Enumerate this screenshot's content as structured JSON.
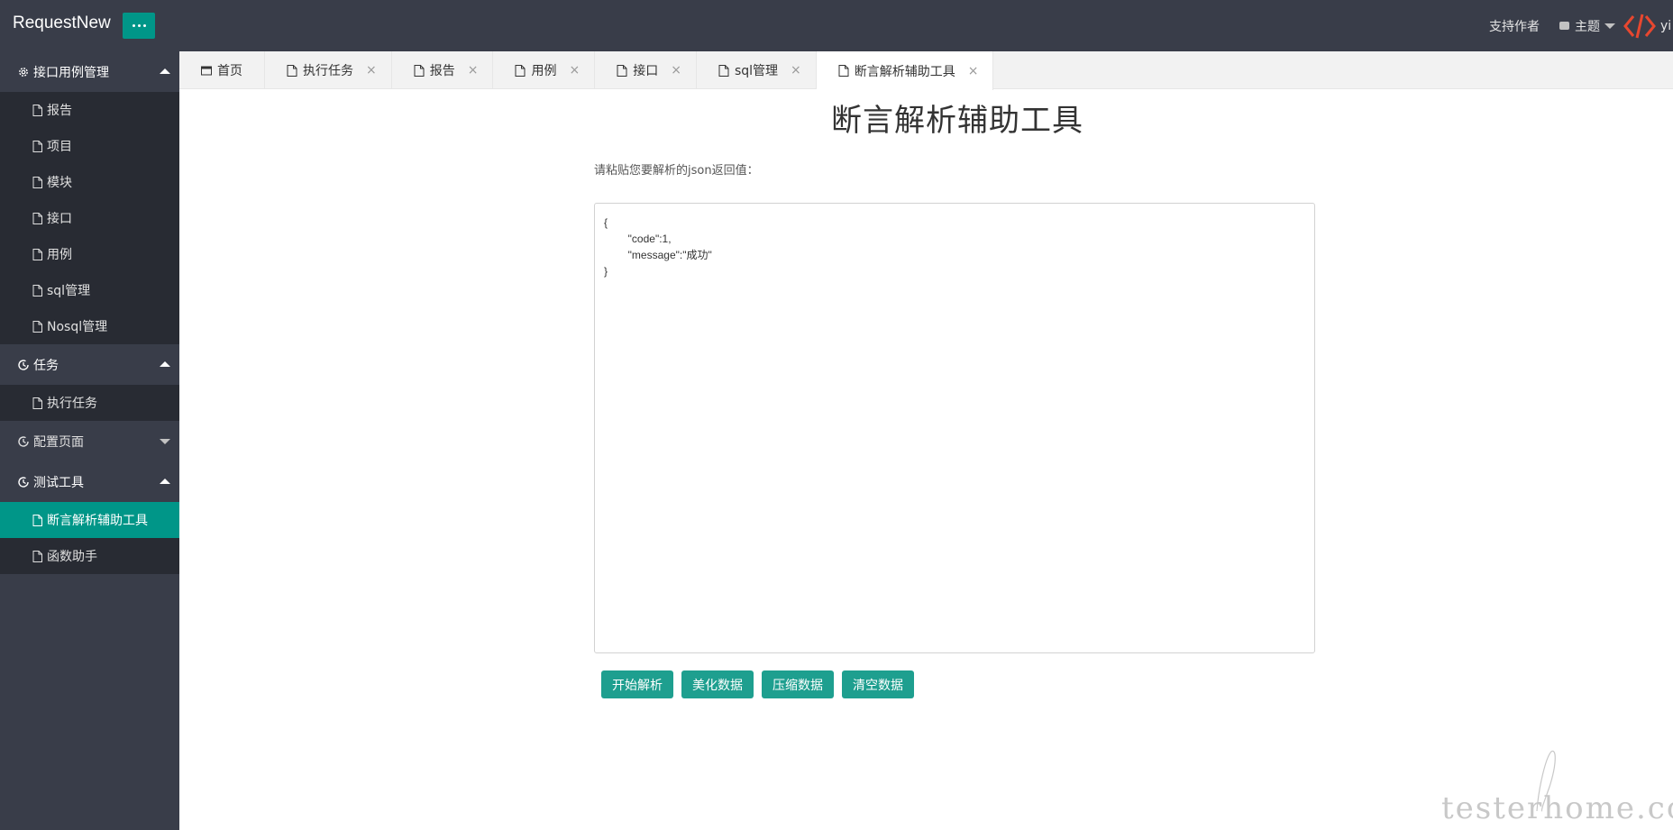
{
  "header": {
    "logo": "RequestNew",
    "support": "支持作者",
    "theme": "主题",
    "username": "yi",
    "colors": {
      "bar": "#393d49",
      "accent": "#009688",
      "code_logo": "#e8472f"
    }
  },
  "sidebar": {
    "groups": [
      {
        "label": "接口用例管理",
        "icon": "gear-icon",
        "expanded": true,
        "items": [
          "报告",
          "项目",
          "模块",
          "接口",
          "用例",
          "sql管理",
          "Nosql管理"
        ]
      },
      {
        "label": "任务",
        "icon": "clock-icon",
        "expanded": true,
        "items": [
          "执行任务"
        ]
      },
      {
        "label": "配置页面",
        "icon": "clock-icon",
        "expanded": false,
        "items": []
      },
      {
        "label": "测试工具",
        "icon": "clock-icon",
        "expanded": true,
        "items": [
          "断言解析辅助工具",
          "函数助手"
        ]
      }
    ],
    "active_item": "断言解析辅助工具"
  },
  "tabs": [
    {
      "label": "首页",
      "icon": "window-icon",
      "closable": false
    },
    {
      "label": "执行任务",
      "icon": "file-icon",
      "closable": true
    },
    {
      "label": "报告",
      "icon": "file-icon",
      "closable": true
    },
    {
      "label": "用例",
      "icon": "file-icon",
      "closable": true
    },
    {
      "label": "接口",
      "icon": "file-icon",
      "closable": true
    },
    {
      "label": "sql管理",
      "icon": "file-icon",
      "closable": true
    },
    {
      "label": "断言解析辅助工具",
      "icon": "file-icon",
      "closable": true,
      "active": true
    }
  ],
  "tab_close_glyph": "×",
  "main": {
    "title": "断言解析辅助工具",
    "prompt": "请粘贴您要解析的json返回值：",
    "json_value": "{\n        \"code\":1,\n        \"message\":\"成功\"\n}",
    "buttons": {
      "parse": "开始解析",
      "beautify": "美化数据",
      "compress": "压缩数据",
      "clear": "清空数据"
    }
  },
  "watermark": "testerhome.com"
}
